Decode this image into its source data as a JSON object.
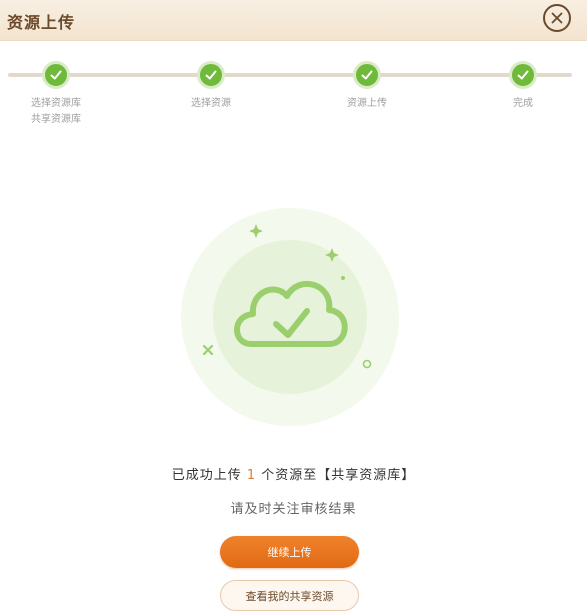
{
  "header": {
    "title": "资源上传"
  },
  "steps": [
    {
      "label": "选择资源库\n共享资源库"
    },
    {
      "label": "选择资源"
    },
    {
      "label": "资源上传"
    },
    {
      "label": "完成"
    }
  ],
  "colors": {
    "accent": "#e37c2e",
    "success": "#6fba3a",
    "brand_brown": "#6b4a2c"
  },
  "result": {
    "prefix": "已成功上传 ",
    "count": "1",
    "suffix": " 个资源至【共享资源库】",
    "subtitle": "请及时关注审核结果"
  },
  "buttons": {
    "continue": "继续上传",
    "view_mine": "查看我的共享资源"
  },
  "icons": {
    "close": "close-icon",
    "step_done": "check-icon",
    "illustration": "cloud-check-icon"
  }
}
